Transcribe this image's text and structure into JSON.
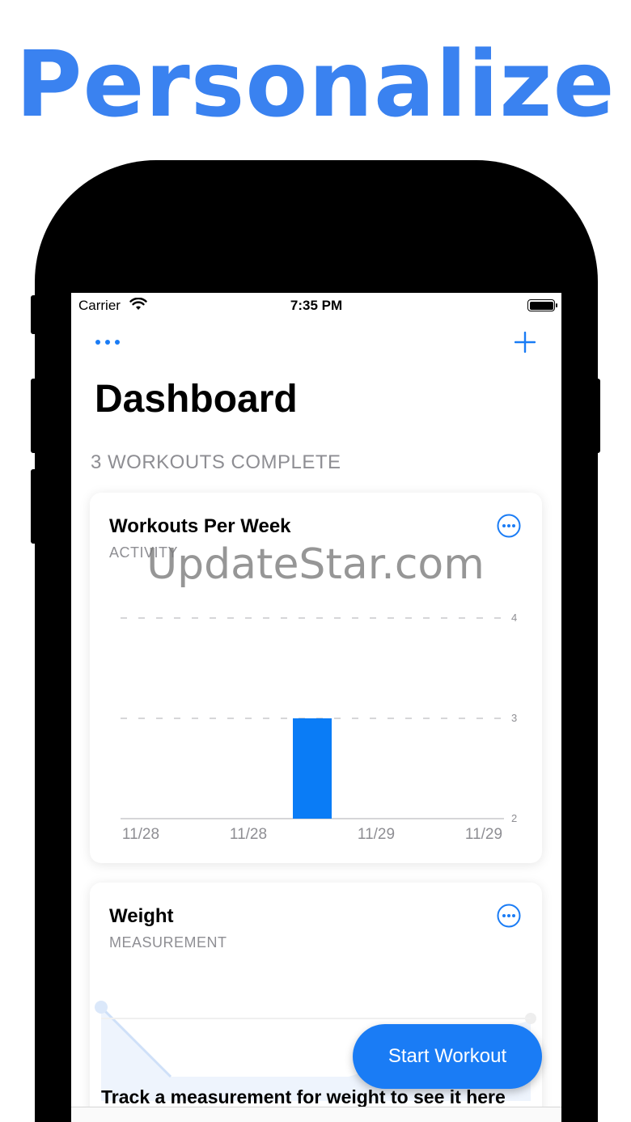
{
  "promo": {
    "headline": "Personalize"
  },
  "status_bar": {
    "carrier": "Carrier",
    "time": "7:35 PM"
  },
  "nav": {
    "more_icon": "ellipsis-icon",
    "add_icon": "plus-icon"
  },
  "dashboard": {
    "title": "Dashboard",
    "section_label": "3 WORKOUTS COMPLETE"
  },
  "cards": [
    {
      "title": "Workouts Per Week",
      "subtitle": "ACTIVITY",
      "menu_icon": "ellipsis-circle-icon"
    },
    {
      "title": "Weight",
      "subtitle": "MEASUREMENT",
      "menu_icon": "ellipsis-circle-icon",
      "empty_message": "Track a measurement for weight to see it here"
    }
  ],
  "chart_data": {
    "type": "bar",
    "categories": [
      "11/28",
      "11/28",
      "11/29",
      "11/29"
    ],
    "values": [
      null,
      3,
      null,
      null
    ],
    "ylim": [
      2,
      4
    ],
    "yticks": [
      "2",
      "3",
      "4"
    ],
    "title": "",
    "xlabel": "",
    "ylabel": "",
    "grid": true,
    "bar_color": "#0a7cf6"
  },
  "watermark": "UpdateStar.com",
  "actions": {
    "start_workout": "Start Workout"
  },
  "colors": {
    "accent": "#1a7cf5",
    "headline": "#3a82f0",
    "secondary_text": "#8e8e93"
  }
}
